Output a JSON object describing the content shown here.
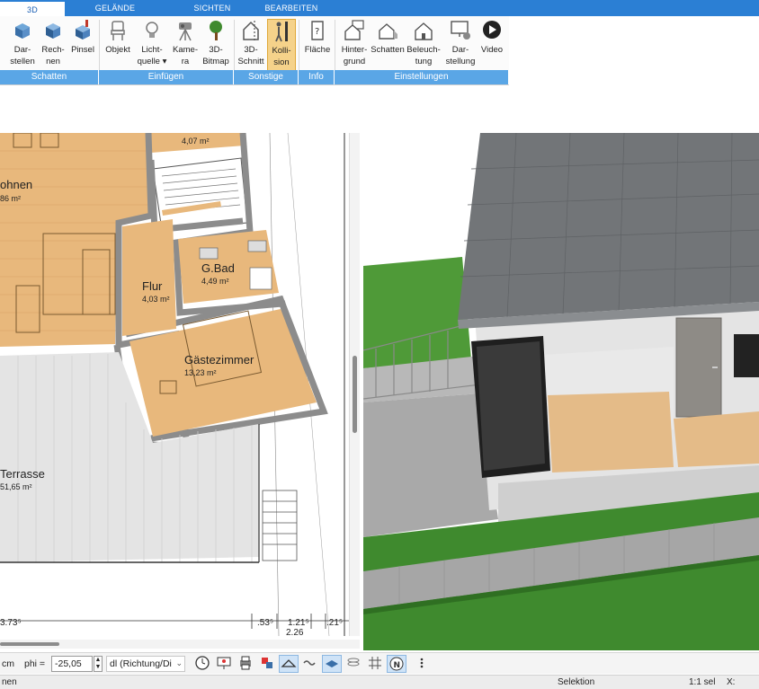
{
  "ribbon": {
    "tabs": [
      {
        "label": "3D",
        "active": true
      },
      {
        "label": "GELÄNDE",
        "active": false
      },
      {
        "label": "SICHTEN",
        "active": false
      },
      {
        "label": "BEARBEITEN",
        "active": false
      }
    ],
    "buttons": {
      "darstellen": "Dar-\nstellen",
      "rechnen": "Rech-\nnen",
      "pinsel": "Pinsel",
      "objekt": "Objekt",
      "lichtquelle": "Licht-\nquelle ▾",
      "kamera": "Kame-\nra",
      "bitmap": "3D-\nBitmap",
      "schnitt": "3D-\nSchnitt",
      "kollision": "Kolli-\nsion",
      "flaeche": "Fläche",
      "hintergrund": "Hinter-\ngrund",
      "schatten": "Schatten",
      "beleuchtung": "Beleuch-\ntung",
      "darstellung": "Dar-\nstellung",
      "video": "Video"
    },
    "groups": {
      "schatten": "Schatten",
      "einfuegen": "Einfügen",
      "sonstige": "Sonstige",
      "info": "Info",
      "einstellungen": "Einstellungen"
    }
  },
  "plan": {
    "rooms": {
      "wohnen_name": "ohnen",
      "wohnen_area": "86 m²",
      "top_area": "4,07 m²",
      "bad_name": "G.Bad",
      "bad_area": "4,49 m²",
      "flur_name": "Flur",
      "flur_area": "4,03 m²",
      "gast_name": "Gästezimmer",
      "gast_area": "13,23 m²",
      "terrasse_name": "Terrasse",
      "terrasse_area": "51,65 m²"
    },
    "dimensions": {
      "d1": "3.73⁵",
      "d2": ".53⁵",
      "d3": "1.21⁵",
      "d4": ".21⁵",
      "d5": "2.26"
    }
  },
  "toolbar": {
    "unit": "cm",
    "phi_label": "phi =",
    "phi_value": "-25,05",
    "degree": "°",
    "direction": "dl (Richtung/Di"
  },
  "status": {
    "left": "nen",
    "mode": "Selektion",
    "scale": "1:1 sel",
    "x": "X:"
  },
  "colors": {
    "accent": "#2b7fd4",
    "group_bar": "#5aa6e6",
    "floor_wood": "#e7b77a",
    "grass": "#3f8a2e",
    "roof": "#6f7275"
  }
}
